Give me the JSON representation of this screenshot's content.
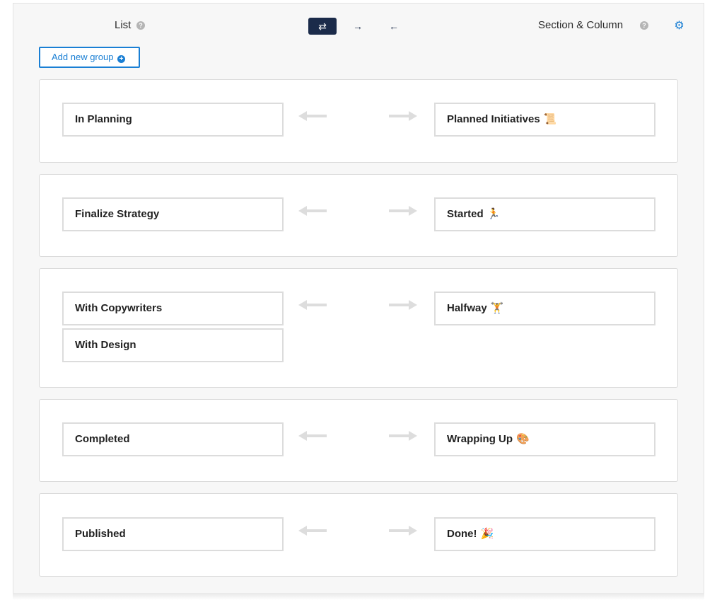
{
  "header": {
    "left_label": "List",
    "right_label": "Section & Column",
    "direction_options": [
      {
        "symbol": "⇄",
        "name": "bidirectional",
        "active": true
      },
      {
        "symbol": "→",
        "name": "list-to-section",
        "active": false
      },
      {
        "symbol": "←",
        "name": "section-to-list",
        "active": false
      }
    ]
  },
  "add_group": {
    "label": "Add new group"
  },
  "groups": [
    {
      "left": [
        "In Planning"
      ],
      "right": "Planned Initiatives",
      "right_emoji": "📜"
    },
    {
      "left": [
        "Finalize Strategy"
      ],
      "right": "Started",
      "right_emoji": "🏃"
    },
    {
      "left": [
        "With Copywriters",
        "With Design"
      ],
      "right": "Halfway",
      "right_emoji": "🏋"
    },
    {
      "left": [
        "Completed"
      ],
      "right": "Wrapping Up",
      "right_emoji": "🎨"
    },
    {
      "left": [
        "Published"
      ],
      "right": "Done!",
      "right_emoji": "🎉"
    }
  ],
  "colors": {
    "accent": "#1a7fd4",
    "active_button": "#1b2b4a",
    "arrow": "#dddddd"
  }
}
